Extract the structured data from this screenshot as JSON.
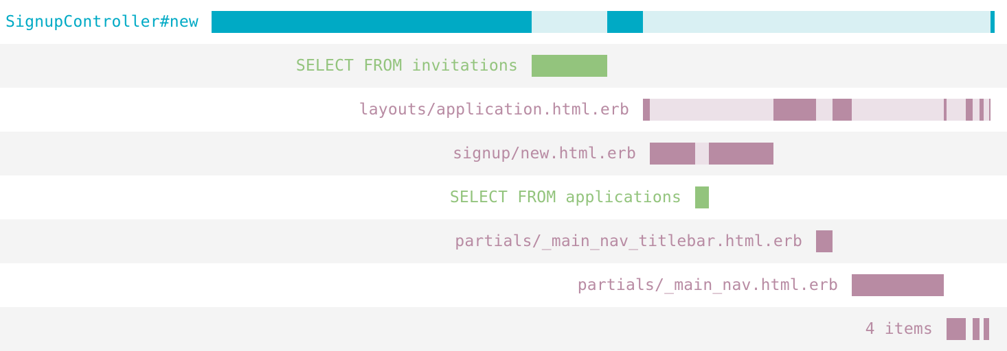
{
  "chart_data": {
    "type": "timeline",
    "colors": {
      "controller": "#00aac5",
      "controller_light": "#d9f0f3",
      "sql": "#93c47d",
      "view": "#b88ba3",
      "view_light": "#ece1e8",
      "row_alt": "#f4f4f4"
    },
    "rows": [
      {
        "label": "SignupController#new",
        "kind": "controller",
        "align": "left",
        "span": [
          0,
          1140
        ],
        "segments": [
          [
            0,
            466
          ],
          [
            576,
            628
          ],
          [
            1134,
            1140
          ]
        ]
      },
      {
        "label": "SELECT FROM invitations",
        "kind": "sql",
        "segments": [
          [
            466,
            576
          ]
        ]
      },
      {
        "label": "layouts/application.html.erb",
        "kind": "view",
        "span": [
          628,
          1134
        ],
        "segments": [
          [
            628,
            638
          ],
          [
            818,
            880
          ],
          [
            904,
            932
          ],
          [
            1066,
            1070
          ],
          [
            1098,
            1108
          ],
          [
            1118,
            1124
          ],
          [
            1132,
            1134
          ]
        ]
      },
      {
        "label": "signup/new.html.erb",
        "kind": "view",
        "span": [
          638,
          818
        ],
        "segments": [
          [
            638,
            704
          ],
          [
            724,
            818
          ]
        ]
      },
      {
        "label": "SELECT FROM applications",
        "kind": "sql",
        "segments": [
          [
            704,
            724
          ]
        ]
      },
      {
        "label": "partials/_main_nav_titlebar.html.erb",
        "kind": "view",
        "segments": [
          [
            880,
            904
          ]
        ]
      },
      {
        "label": "partials/_main_nav.html.erb",
        "kind": "view",
        "segments": [
          [
            932,
            1066
          ]
        ]
      },
      {
        "label": "4 items",
        "kind": "view",
        "segments": [
          [
            1070,
            1098
          ],
          [
            1108,
            1118
          ],
          [
            1124,
            1132
          ]
        ]
      }
    ]
  }
}
